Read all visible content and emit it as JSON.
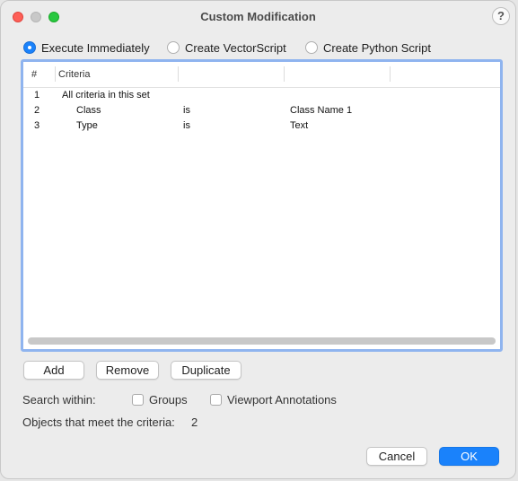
{
  "window": {
    "title": "Custom Modification",
    "help_label": "?"
  },
  "mode": {
    "options": [
      {
        "label": "Execute Immediately",
        "selected": true
      },
      {
        "label": "Create VectorScript",
        "selected": false
      },
      {
        "label": "Create Python Script",
        "selected": false
      }
    ]
  },
  "table": {
    "headers": [
      "#",
      "Criteria",
      "",
      "",
      ""
    ],
    "rows": [
      {
        "num": "1",
        "criteria": "All criteria in this set",
        "op": "",
        "value": ""
      },
      {
        "num": "2",
        "criteria": "Class",
        "op": "is",
        "value": "Class Name 1"
      },
      {
        "num": "3",
        "criteria": "Type",
        "op": "is",
        "value": "Text"
      }
    ]
  },
  "buttons": {
    "add": "Add",
    "remove": "Remove",
    "duplicate": "Duplicate",
    "cancel": "Cancel",
    "ok": "OK"
  },
  "search": {
    "label": "Search within:",
    "groups": {
      "label": "Groups",
      "checked": false
    },
    "viewport_annotations": {
      "label": "Viewport Annotations",
      "checked": false
    }
  },
  "result": {
    "label": "Objects that meet the criteria:",
    "count": "2"
  },
  "colors": {
    "accent": "#1a82fb",
    "focus_ring": "#8fb4ef"
  }
}
